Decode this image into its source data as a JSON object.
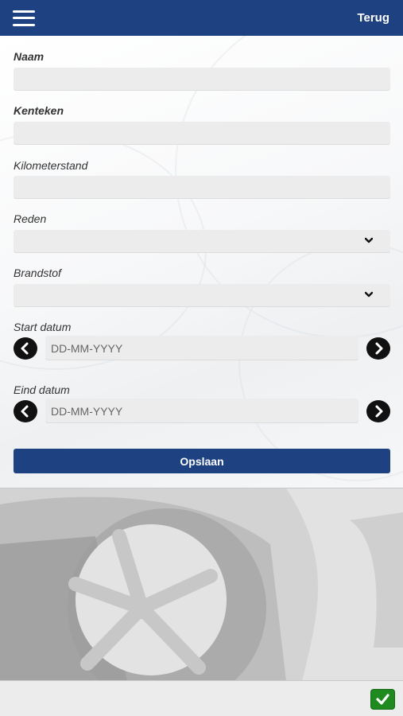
{
  "header": {
    "menu_icon": "hamburger-menu-icon",
    "back_label": "Terug",
    "color": "#1d4181"
  },
  "form": {
    "naam_label": "Naam",
    "naam_value": "",
    "kenteken_label": "Kenteken",
    "kenteken_value": "",
    "kilometerstand_label": "Kilometerstand",
    "kilometerstand_value": "",
    "reden_label": "Reden",
    "reden_value": "",
    "brandstof_label": "Brandstof",
    "brandstof_value": "",
    "start_datum_label": "Start datum",
    "start_datum_placeholder": "DD-MM-YYYY",
    "eind_datum_label": "Eind datum",
    "eind_datum_placeholder": "DD-MM-YYYY",
    "save_label": "Opslaan"
  },
  "footer": {
    "confirm_icon": "checkmark-icon",
    "confirm_color": "#1f8a1f"
  }
}
